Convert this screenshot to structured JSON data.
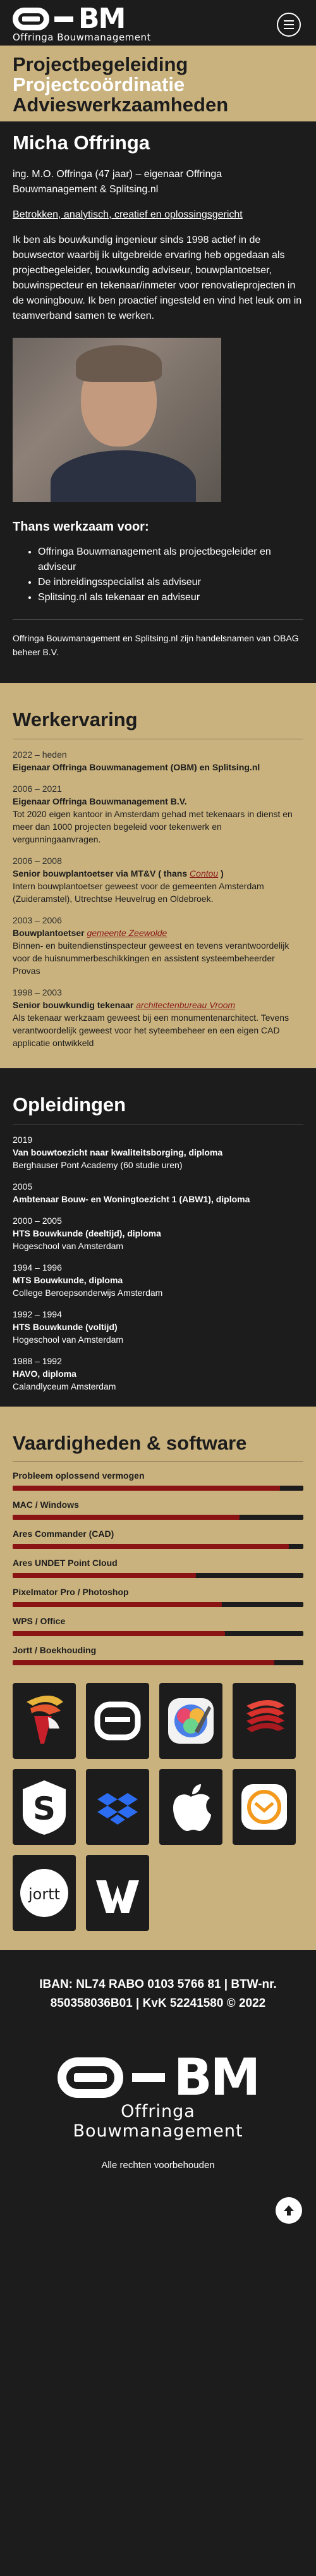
{
  "header": {
    "logo_sub": "Offringa Bouwmanagement",
    "logo_text": "BM",
    "menu_icon": "hamburger-icon"
  },
  "hero": {
    "line1": "Projectbegeleiding",
    "line2": "Projectcoördinatie",
    "line3": "Advieswerkzaamheden"
  },
  "intro": {
    "name": "Micha Offringa",
    "tagline": "ing. M.O. Offringa (47 jaar) – eigenaar Offringa Bouwmanagement & Splitsing.nl",
    "traits": "Betrokken, analytisch, creatief en oplossingsgericht",
    "bio": "Ik ben als bouwkundig ingenieur sinds 1998 actief in de bouwsector waarbij ik uitgebreide ervaring heb opgedaan als projectbegeleider, bouwkundig adviseur, bouwplantoetser, bouwinspecteur en tekenaar/inmeter voor renovatieprojecten in de woningbouw. Ik ben proactief ingesteld en vind het leuk om in teamverband samen te werken.",
    "current_heading": "Thans werkzaam voor:",
    "current_items": [
      "Offringa Bouwmanagement als projectbegeleider en adviseur",
      "De inbreidingsspecialist als adviseur",
      "Splitsing.nl als tekenaar en adviseur"
    ],
    "trade_names": "Offringa Bouwmanagement en Splitsing.nl zijn handelsnamen van OBAG beheer B.V."
  },
  "work": {
    "heading": "Werkervaring",
    "jobs": [
      {
        "period": "2022 – heden",
        "role": "Eigenaar Offringa Bouwmanagement (OBM) en Splitsing.nl",
        "link": "",
        "desc": ""
      },
      {
        "period": "2006 – 2021",
        "role": "Eigenaar Offringa Bouwmanagement B.V.",
        "link": "",
        "desc": "Tot 2020 eigen kantoor in Amsterdam gehad met tekenaars in dienst en meer dan 1000 projecten begeleid voor tekenwerk en vergunningaanvragen."
      },
      {
        "period": "2006 – 2008",
        "role": "Senior bouwplantoetser via MT&V ( thans ",
        "link": "Contou",
        "role_end": " )",
        "desc": "Intern bouwplantoetser geweest voor de gemeenten Amsterdam (Zuideramstel), Utrechtse Heuvelrug en Oldebroek."
      },
      {
        "period": "2003 – 2006",
        "role": "Bouwplantoetser ",
        "link": "gemeente Zeewolde",
        "role_end": "",
        "desc": "Binnen- en buitendienstinspecteur geweest en tevens verantwoordelijk voor de huisnummerbeschikkingen en assistent systeembeheerder Provas"
      },
      {
        "period": "1998 – 2003",
        "role": "Senior bouwkundig tekenaar ",
        "link": "architectenbureau Vroom",
        "role_end": "",
        "desc": "Als tekenaar werkzaam geweest bij een monumentenarchitect. Tevens verantwoordelijk geweest voor het syteembeheer en een eigen CAD applicatie ontwikkeld"
      }
    ]
  },
  "education": {
    "heading": "Opleidingen",
    "courses": [
      {
        "year": "2019",
        "name": "Van bouwtoezicht naar kwaliteitsborging, diploma",
        "school": "Berghauser Pont Academy (60 studie uren)"
      },
      {
        "year": "2005",
        "name": "Ambtenaar Bouw- en Woningtoezicht 1 (ABW1), diploma",
        "school": ""
      },
      {
        "year": "2000 – 2005",
        "name": "HTS Bouwkunde (deeltijd), diploma",
        "school": "Hogeschool van Amsterdam"
      },
      {
        "year": "1994 – 1996",
        "name": "MTS Bouwkunde, diploma",
        "school": "College Beroepsonderwijs Amsterdam"
      },
      {
        "year": "1992 – 1994",
        "name": "HTS Bouwkunde (voltijd)",
        "school": "Hogeschool van Amsterdam"
      },
      {
        "year": "1988 – 1992",
        "name": "HAVO, diploma",
        "school": "Calandlyceum Amsterdam"
      }
    ]
  },
  "skills": {
    "heading": "Vaardigheden & software",
    "items": [
      {
        "label": "Probleem oplossend vermogen",
        "level": 0.92
      },
      {
        "label": "MAC / Windows",
        "level": 0.78
      },
      {
        "label": "Ares Commander (CAD)",
        "level": 0.95
      },
      {
        "label": "Ares UNDET Point Cloud",
        "level": 0.63
      },
      {
        "label": "Pixelmator Pro / Photoshop",
        "level": 0.72
      },
      {
        "label": "WPS / Office",
        "level": 0.73
      },
      {
        "label": "Jortt / Boekhouding",
        "level": 0.9
      }
    ],
    "bar_color": "#8a1414"
  },
  "apps": [
    {
      "icon": "ares-commander-icon"
    },
    {
      "icon": "offringa-logo-icon"
    },
    {
      "icon": "pixelmator-pro-icon"
    },
    {
      "icon": "ares-point-cloud-icon"
    },
    {
      "icon": "splitsing-s-icon"
    },
    {
      "icon": "dropbox-icon"
    },
    {
      "icon": "apple-icon"
    },
    {
      "icon": "mail-icon"
    },
    {
      "icon": "jortt-icon"
    },
    {
      "icon": "wps-office-icon"
    }
  ],
  "footer": {
    "bank_line1": "IBAN: NL74 RABO 0103 5766 81 | BTW-nr.",
    "bank_line2": "850358036B01 | KvK 52241580 © 2022",
    "logo_text": "BM",
    "logo_sub": "Offringa Bouwmanagement",
    "rights": "Alle rechten voorbehouden",
    "jortt_label": "jortt"
  },
  "colors": {
    "accent": "#c9b27e",
    "dark": "#1c1c1c",
    "link": "#8a1a1a"
  }
}
